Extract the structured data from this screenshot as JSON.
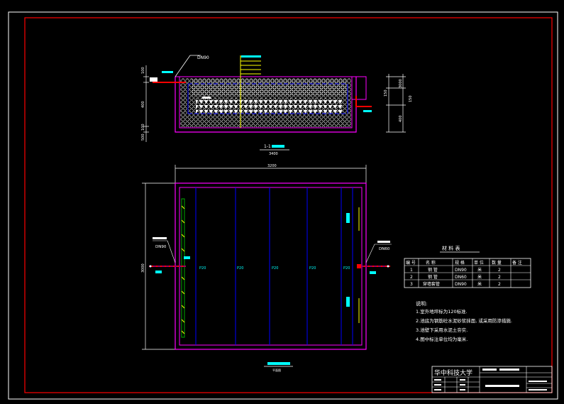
{
  "section_view": {
    "label": "1-1",
    "scale": "1:50",
    "total_width_dim": "3400",
    "inlet_pipe": "DN90",
    "dims_left": [
      "100",
      "400",
      "100",
      "500"
    ],
    "dims_right": [
      "3000",
      "150",
      "400",
      "150"
    ]
  },
  "plan_view": {
    "label": "平面图",
    "total_width_dim": "3200",
    "total_height_dim": "3000",
    "left_pipe": "DN90",
    "right_pipe": "DN60",
    "channel_labels": [
      "P20",
      "P20",
      "P20",
      "P20",
      "P20"
    ]
  },
  "materials_table": {
    "title": "材 料 表",
    "headers": [
      "编 号",
      "名 称",
      "规 格",
      "单 位",
      "数 量",
      "备 注"
    ],
    "rows": [
      [
        "1",
        "钢 管",
        "DN90",
        "米",
        "2",
        ""
      ],
      [
        "2",
        "钢 管",
        "DN60",
        "米",
        "2",
        ""
      ],
      [
        "3",
        "穿墙套管",
        "DN90",
        "米",
        "2",
        ""
      ]
    ]
  },
  "notes": {
    "title": "说明:",
    "items": [
      "1.室外地坪标为120标准.",
      "2.池底为钢筋砼水泥砂浆抹面, 或采用防渗措施.",
      "3.池壁下采用水泥土夯实.",
      "4.图中标注单位均为毫米."
    ]
  },
  "title_block": {
    "university": "华中科技大学",
    "project": "",
    "drawing_no": ""
  },
  "colors": {
    "frame": "#ff0000",
    "wall": "#ff00ff",
    "channel": "#0000ff",
    "label": "#00ffff",
    "pipe": "#ff0000",
    "gravel": "#ffffff",
    "riser": "#ffff00"
  }
}
